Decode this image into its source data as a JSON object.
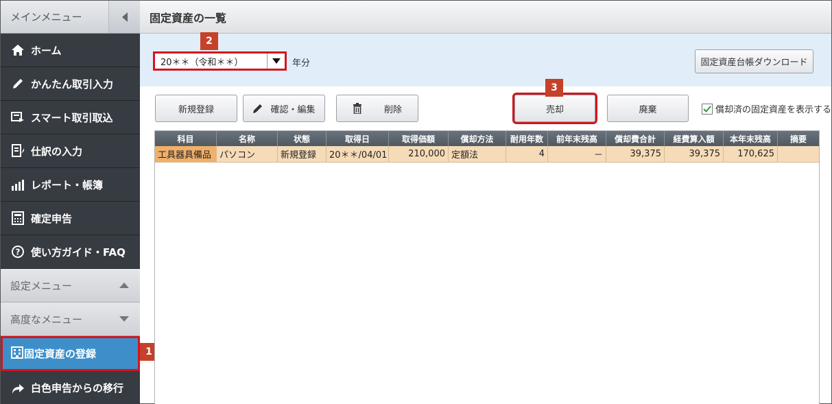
{
  "sidebar": {
    "title": "メインメニュー",
    "items": [
      {
        "label": "ホーム",
        "icon": "home-icon"
      },
      {
        "label": "かんたん取引入力",
        "icon": "pencil-icon"
      },
      {
        "label": "スマート取引取込",
        "icon": "import-icon"
      },
      {
        "label": "仕訳の入力",
        "icon": "journal-icon"
      },
      {
        "label": "レポート・帳簿",
        "icon": "chart-icon"
      },
      {
        "label": "確定申告",
        "icon": "calculator-icon"
      },
      {
        "label": "使い方ガイド・FAQ",
        "icon": "help-icon"
      }
    ],
    "settings_menu": "設定メニュー",
    "advanced_menu": "高度なメニュー",
    "active_item": "固定資産の登録",
    "migrate_item": "白色申告からの移行"
  },
  "header": {
    "title": "固定資産の一覧"
  },
  "filter": {
    "year_value": "20＊＊（令和＊＊）",
    "year_suffix": "年分",
    "download_label": "固定資産台帳ダウンロード"
  },
  "toolbar": {
    "new_label": "新規登録",
    "edit_label": "確認・編集",
    "delete_label": "削除",
    "sell_label": "売却",
    "dispose_label": "廃棄",
    "show_depreciated_label": "償却済の固定資産を表示する",
    "show_depreciated_checked": true
  },
  "badges": {
    "b1": "1",
    "b2": "2",
    "b3": "3"
  },
  "table": {
    "columns": [
      "科目",
      "名称",
      "状態",
      "取得日",
      "取得価額",
      "償却方法",
      "耐用年数",
      "前年末残高",
      "償却費合計",
      "経費算入額",
      "本年末残高",
      "摘要"
    ],
    "rows": [
      [
        "工具器具備品",
        "パソコン",
        "新規登録",
        "20＊＊/04/01",
        "210,000",
        "定額法",
        "4",
        "－",
        "39,375",
        "39,375",
        "170,625",
        ""
      ]
    ]
  },
  "colors": {
    "accent": "#3e8fc9",
    "highlight": "#d4141d",
    "badge": "#c5412a",
    "row": "#f6dbb8"
  }
}
